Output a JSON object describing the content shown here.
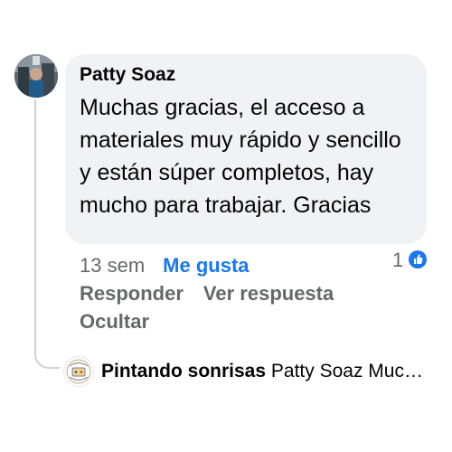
{
  "comment": {
    "author": "Patty Soaz",
    "text": "Muchas gracias, el acceso a materiales muy rápido y sencillo y están súper completos, hay mucho para trabajar. Gracias",
    "time": "13 sem",
    "like_label": "Me gusta",
    "reply_label": "Responder",
    "view_reply_label": "Ver respuesta",
    "hide_label": "Ocultar",
    "reaction_count": "1",
    "reaction_icon": "thumbs-up-icon",
    "avatar_icon": "user-avatar"
  },
  "reply": {
    "author": "Pintando sonrisas",
    "preview": "Patty Soaz Muc…",
    "avatar_icon": "page-logo"
  },
  "colors": {
    "bubble_bg": "#f0f2f5",
    "link_blue": "#1877f2",
    "secondary_text": "#65676b",
    "primary_text": "#050505"
  }
}
